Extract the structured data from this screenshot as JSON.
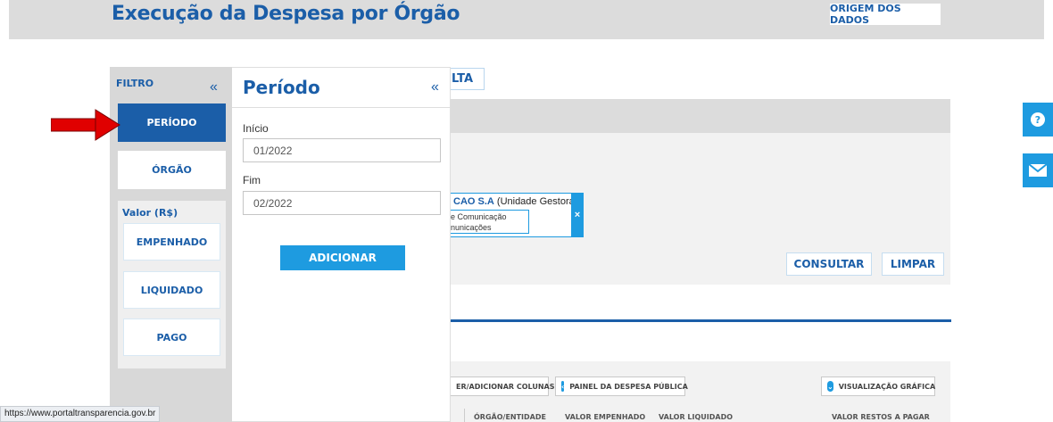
{
  "header": {
    "title": "Execução da Despesa por Órgão",
    "origem_label": "ORIGEM DOS DADOS"
  },
  "filter": {
    "title": "FILTRO",
    "collapse_glyph": "«",
    "periodo_label": "PERÍODO",
    "orgao_label": "ÓRGÃO",
    "valor_label": "Valor (R$)",
    "empenhado_label": "EMPENHADO",
    "liquidado_label": "LIQUIDADO",
    "pago_label": "PAGO"
  },
  "periodo_panel": {
    "title": "Período",
    "collapse_glyph": "«",
    "inicio_label": "Início",
    "inicio_value": "01/2022",
    "fim_label": "Fim",
    "fim_value": "02/2022",
    "adicionar_label": "ADICIONAR"
  },
  "background": {
    "tab_fragment": "LTA",
    "chip_title_bold": "CAO S.A",
    "chip_title_rest": " (Unidade Gestora)",
    "chip_line1": "e Comunicação",
    "chip_line2": "nunicações",
    "chip_remove": "×",
    "consultar_label": "CONSULTAR",
    "limpar_label": "LIMPAR",
    "cols_pill": "ER/ADICIONAR COLUNAS",
    "painel_pill": "PAINEL DA DESPESA PÚBLICA",
    "visualizacao_pill": "VISUALIZAÇÃO GRÁFICA",
    "table_headers": [
      "ÓRGÃO/ENTIDADE",
      "VALOR EMPENHADO",
      "VALOR LIQUIDADO",
      "VALOR RESTOS A PAGAR"
    ]
  },
  "side": {
    "help_icon": "question-circle-icon",
    "mail_icon": "envelope-icon"
  },
  "status_bar": {
    "url": "https://www.portaltransparencia.gov.br"
  },
  "colors": {
    "primary_blue": "#1b5ea8",
    "accent_blue": "#1e9be0",
    "arrow_red": "#e00000"
  }
}
